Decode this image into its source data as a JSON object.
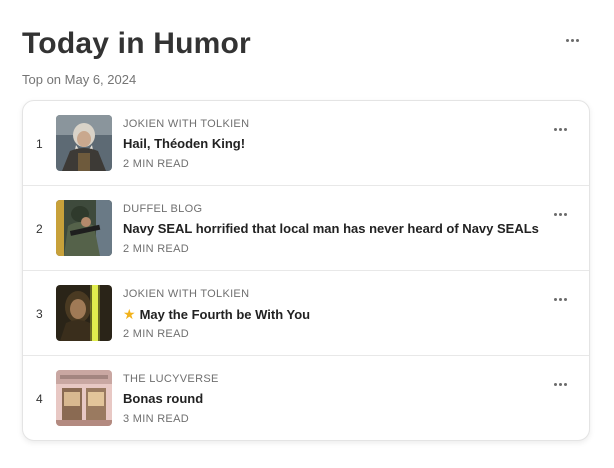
{
  "header": {
    "title": "Today in Humor",
    "subtitle": "Top on May 6, 2024",
    "menu_icon": "more-horizontal-icon"
  },
  "posts": [
    {
      "rank": "1",
      "publication": "JOKIEN WITH TOLKIEN",
      "title": "Hail, Théoden King!",
      "read_time": "2 MIN READ",
      "icon": ""
    },
    {
      "rank": "2",
      "publication": "DUFFEL BLOG",
      "title": "Navy SEAL horrified that local man has never heard of Navy SEALs",
      "read_time": "2 MIN READ",
      "icon": ""
    },
    {
      "rank": "3",
      "publication": "JOKIEN WITH TOLKIEN",
      "title": "May the Fourth be With You",
      "read_time": "2 MIN READ",
      "icon": "star-emoji-icon"
    },
    {
      "rank": "4",
      "publication": "THE LUCYVERSE",
      "title": "Bonas round",
      "read_time": "3 MIN READ",
      "icon": ""
    }
  ],
  "colors": {
    "title": "#333333",
    "meta": "#6f6f6f",
    "star": "#f2b21b",
    "border": "#e4e4e4"
  }
}
